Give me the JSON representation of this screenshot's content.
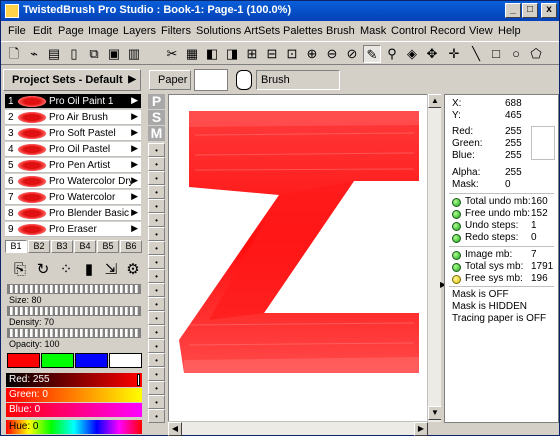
{
  "window": {
    "title": "TwistedBrush Pro Studio : Book-1: Page-1 (100.0%)"
  },
  "title_buttons": [
    "_",
    "□",
    "x"
  ],
  "menu": [
    "File",
    "Edit",
    "Page",
    "Image",
    "Layers",
    "Filters",
    "Solutions",
    "ArtSets",
    "Palettes",
    "Brush",
    "Mask",
    "Control",
    "Record",
    "View",
    "Help"
  ],
  "toolbar_icons": [
    "new-page-icon",
    "open-icon",
    "save-icon",
    "page-icon",
    "copy-icon",
    "paste-icon",
    "cut-icon",
    "page-nav-icon",
    "page-prev-icon",
    "page-next-icon",
    "page-add-icon",
    "page-delete-icon",
    "zoom-in-icon",
    "zoom-out-icon",
    "zoom-fit-icon",
    "brush-tool-icon",
    "eyedropper-icon",
    "fill-icon",
    "move-icon",
    "line-icon",
    "rect-icon",
    "ellipse-icon",
    "polygon-icon"
  ],
  "project_sets": {
    "label": "Project Sets - Default"
  },
  "brushes": [
    {
      "num": "1",
      "label": "Pro Oil Paint 1",
      "selected": true
    },
    {
      "num": "2",
      "label": "Pro Air Brush"
    },
    {
      "num": "3",
      "label": "Pro Soft Pastel"
    },
    {
      "num": "4",
      "label": "Pro Oil Pastel"
    },
    {
      "num": "5",
      "label": "Pro Pen Artist"
    },
    {
      "num": "6",
      "label": "Pro Watercolor Dry"
    },
    {
      "num": "7",
      "label": "Pro Watercolor"
    },
    {
      "num": "8",
      "label": "Pro Blender Basic"
    },
    {
      "num": "9",
      "label": "Pro Eraser"
    }
  ],
  "banks": [
    "B1",
    "B2",
    "B3",
    "B4",
    "B5",
    "B6"
  ],
  "brush_tool_icons": [
    "brush-settings-icon",
    "refresh-icon",
    "dots-icon",
    "layer-icon",
    "resize-icon",
    "gear-icon"
  ],
  "sliders": {
    "size": "Size: 80",
    "density": "Density: 70",
    "opacity": "Opacity: 100"
  },
  "swatches": [
    "#ff0000",
    "#00ff00",
    "#0000ff",
    "#ffffff"
  ],
  "color_bars": {
    "red": "Red: 255",
    "green": "Green: 0",
    "blue": "Blue: 0",
    "hue": "Hue: 0"
  },
  "top_controls": {
    "paper_label": "Paper",
    "brush_field": "Brush"
  },
  "psm": [
    "P",
    "S",
    "M"
  ],
  "slots_count": 20,
  "info": {
    "x_label": "X:",
    "x_val": "688",
    "y_label": "Y:",
    "y_val": "465",
    "red_label": "Red:",
    "red_val": "255",
    "green_label": "Green:",
    "green_val": "255",
    "blue_label": "Blue:",
    "blue_val": "255",
    "alpha_label": "Alpha:",
    "alpha_val": "255",
    "mask_label": "Mask:",
    "mask_val": "0",
    "total_undo_label": "Total undo mb:",
    "total_undo_val": "160",
    "free_undo_label": "Free undo mb:",
    "free_undo_val": "152",
    "undo_steps_label": "Undo steps:",
    "undo_steps_val": "1",
    "redo_steps_label": "Redo steps:",
    "redo_steps_val": "0",
    "image_mb_label": "Image mb:",
    "image_mb_val": "7",
    "total_sys_label": "Total sys mb:",
    "total_sys_val": "1791",
    "free_sys_label": "Free sys mb:",
    "free_sys_val": "196",
    "mask_state": "Mask is OFF",
    "mask_hidden": "Mask is HIDDEN",
    "tracing": "Tracing paper is OFF"
  }
}
